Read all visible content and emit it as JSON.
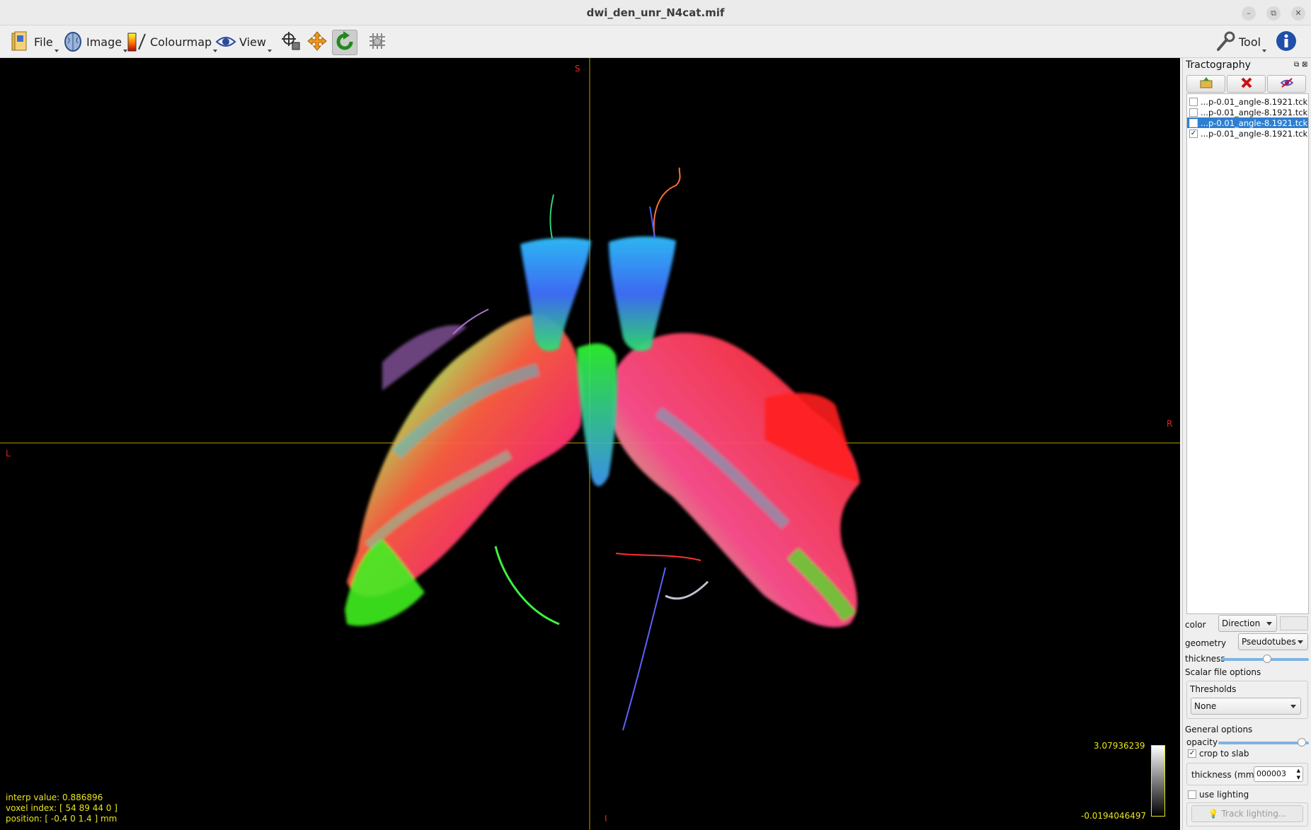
{
  "window": {
    "title": "dwi_den_unr_N4cat.mif",
    "minimize_glyph": "–",
    "restore_glyph": "⧉",
    "close_glyph": "✕"
  },
  "toolbar": {
    "file_label": "File",
    "image_label": "Image",
    "colourmap_label": "Colourmap",
    "view_label": "View",
    "tool_label": "Tool"
  },
  "viewport": {
    "orientation": {
      "top": "S",
      "bottom": "I",
      "left": "L",
      "right": "R"
    },
    "info": {
      "interp_value": "interp value: 0.886896",
      "voxel_index": "voxel index: [ 54 89 44 0 ]",
      "position": "position: [ -0.4 0 1.4 ] mm"
    },
    "colorbar": {
      "max": "3.07936239",
      "min": "-0.0194046497"
    }
  },
  "panel": {
    "title": "Tractography",
    "files": [
      {
        "name": "...p-0.01_angle-8.1921.tck",
        "checked": false,
        "selected": false,
        "check_glyph": ""
      },
      {
        "name": "...p-0.01_angle-8.1921.tck",
        "checked": false,
        "selected": false,
        "check_glyph": ""
      },
      {
        "name": "...p-0.01_angle-8.1921.tck",
        "checked": false,
        "selected": true,
        "check_glyph": ""
      },
      {
        "name": "...p-0.01_angle-8.1921.tck",
        "checked": true,
        "selected": false,
        "check_glyph": "✓"
      }
    ],
    "color_label": "color",
    "color_value": "Direction",
    "geometry_label": "geometry",
    "geometry_value": "Pseudotubes",
    "thickness_label": "thickness",
    "thickness_level": 0.53,
    "scalar_file_options": "Scalar file options",
    "thresholds_label": "Thresholds",
    "thresholds_value": "None",
    "general_options": "General options",
    "opacity_label": "opacity",
    "opacity_level": 0.97,
    "crop_to_slab_label": "crop to slab",
    "crop_to_slab_checked": true,
    "crop_glyph": "✓",
    "slab_thickness_label": "thickness (mm)",
    "slab_thickness_value": "000003",
    "use_lighting_label": "use lighting",
    "use_lighting_checked": false,
    "track_lighting_label": "Track lighting..."
  }
}
